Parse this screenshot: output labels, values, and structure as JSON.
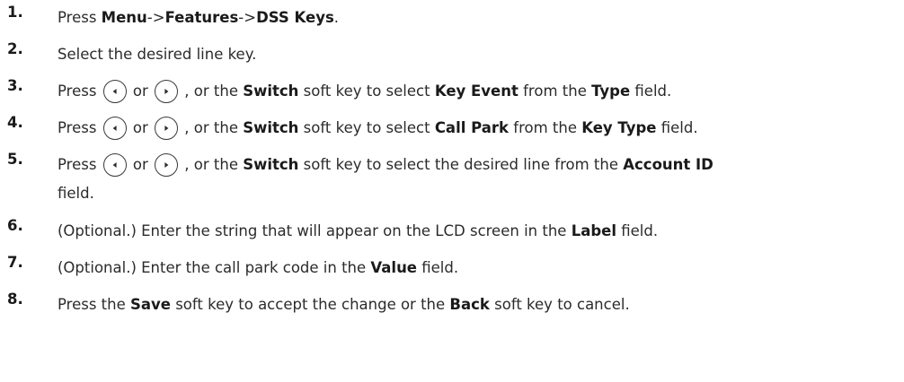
{
  "steps": [
    {
      "num": "1.",
      "segments": [
        {
          "t": "Press "
        },
        {
          "t": "Menu",
          "b": true
        },
        {
          "t": "->"
        },
        {
          "t": "Features",
          "b": true
        },
        {
          "t": "->"
        },
        {
          "t": "DSS Keys",
          "b": true
        },
        {
          "t": "."
        }
      ]
    },
    {
      "num": "2.",
      "segments": [
        {
          "t": "Select the desired line key."
        }
      ]
    },
    {
      "num": "3.",
      "segments": [
        {
          "t": "Press "
        },
        {
          "icon": "left-key-icon"
        },
        {
          "t": " or "
        },
        {
          "icon": "right-key-icon"
        },
        {
          "t": " , or the "
        },
        {
          "t": "Switch",
          "b": true
        },
        {
          "t": " soft key to select "
        },
        {
          "t": "Key Event",
          "b": true
        },
        {
          "t": " from the "
        },
        {
          "t": "Type",
          "b": true
        },
        {
          "t": " field."
        }
      ]
    },
    {
      "num": "4.",
      "segments": [
        {
          "t": "Press "
        },
        {
          "icon": "left-key-icon"
        },
        {
          "t": " or "
        },
        {
          "icon": "right-key-icon"
        },
        {
          "t": " , or the "
        },
        {
          "t": "Switch",
          "b": true
        },
        {
          "t": " soft key to select "
        },
        {
          "t": "Call Park",
          "b": true
        },
        {
          "t": " from the "
        },
        {
          "t": "Key Type",
          "b": true
        },
        {
          "t": " field."
        }
      ]
    },
    {
      "num": "5.",
      "segments": [
        {
          "t": "Press "
        },
        {
          "icon": "left-key-icon"
        },
        {
          "t": " or "
        },
        {
          "icon": "right-key-icon"
        },
        {
          "t": " , or the "
        },
        {
          "t": "Switch",
          "b": true
        },
        {
          "t": " soft key to select the desired line from the "
        },
        {
          "t": "Account ID",
          "b": true
        },
        {
          "br": true
        },
        {
          "t": "field."
        }
      ]
    },
    {
      "num": "6.",
      "segments": [
        {
          "t": "(Optional.) Enter the string that will appear on the LCD screen in the "
        },
        {
          "t": "Label",
          "b": true
        },
        {
          "t": " field."
        }
      ]
    },
    {
      "num": "7.",
      "segments": [
        {
          "t": "(Optional.) Enter the call park code in the "
        },
        {
          "t": "Value",
          "b": true
        },
        {
          "t": " field."
        }
      ]
    },
    {
      "num": "8.",
      "segments": [
        {
          "t": "Press the "
        },
        {
          "t": "Save",
          "b": true
        },
        {
          "t": " soft key to accept the change or the "
        },
        {
          "t": "Back",
          "b": true
        },
        {
          "t": " soft key to cancel."
        }
      ]
    }
  ]
}
